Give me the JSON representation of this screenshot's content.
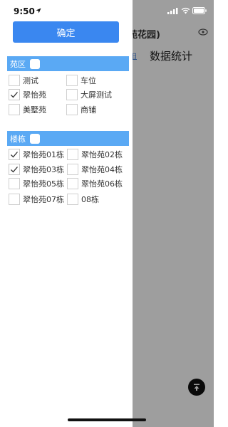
{
  "status_bar": {
    "time": "9:50"
  },
  "background": {
    "title": "苑花园)",
    "link_text": "旧",
    "stats_title": "数据统计"
  },
  "drawer": {
    "confirm_label": "确定",
    "section1": {
      "title": "苑区",
      "options": [
        {
          "label": "测试",
          "checked": false
        },
        {
          "label": "车位",
          "checked": false
        },
        {
          "label": "翠怡苑",
          "checked": true
        },
        {
          "label": "大屏测试",
          "checked": false
        },
        {
          "label": "美墅苑",
          "checked": false
        },
        {
          "label": "商铺",
          "checked": false
        }
      ]
    },
    "section2": {
      "title": "楼栋",
      "options": [
        {
          "label": "翠怡苑01栋",
          "checked": true
        },
        {
          "label": "翠怡苑02栋",
          "checked": false
        },
        {
          "label": "翠怡苑03栋",
          "checked": true
        },
        {
          "label": "翠怡苑04栋",
          "checked": false
        },
        {
          "label": "翠怡苑05栋",
          "checked": false
        },
        {
          "label": "翠怡苑06栋",
          "checked": false
        },
        {
          "label": "翠怡苑07栋",
          "checked": false
        },
        {
          "label": "08栋",
          "checked": false
        }
      ]
    }
  },
  "colors": {
    "accent": "#3a87f0",
    "section_header": "#5aa9f4",
    "fab": "#111111"
  },
  "icons": [
    "location-arrow-icon",
    "signal-icon",
    "wifi-icon",
    "battery-icon",
    "eye-icon",
    "scroll-top-icon",
    "check-icon"
  ]
}
